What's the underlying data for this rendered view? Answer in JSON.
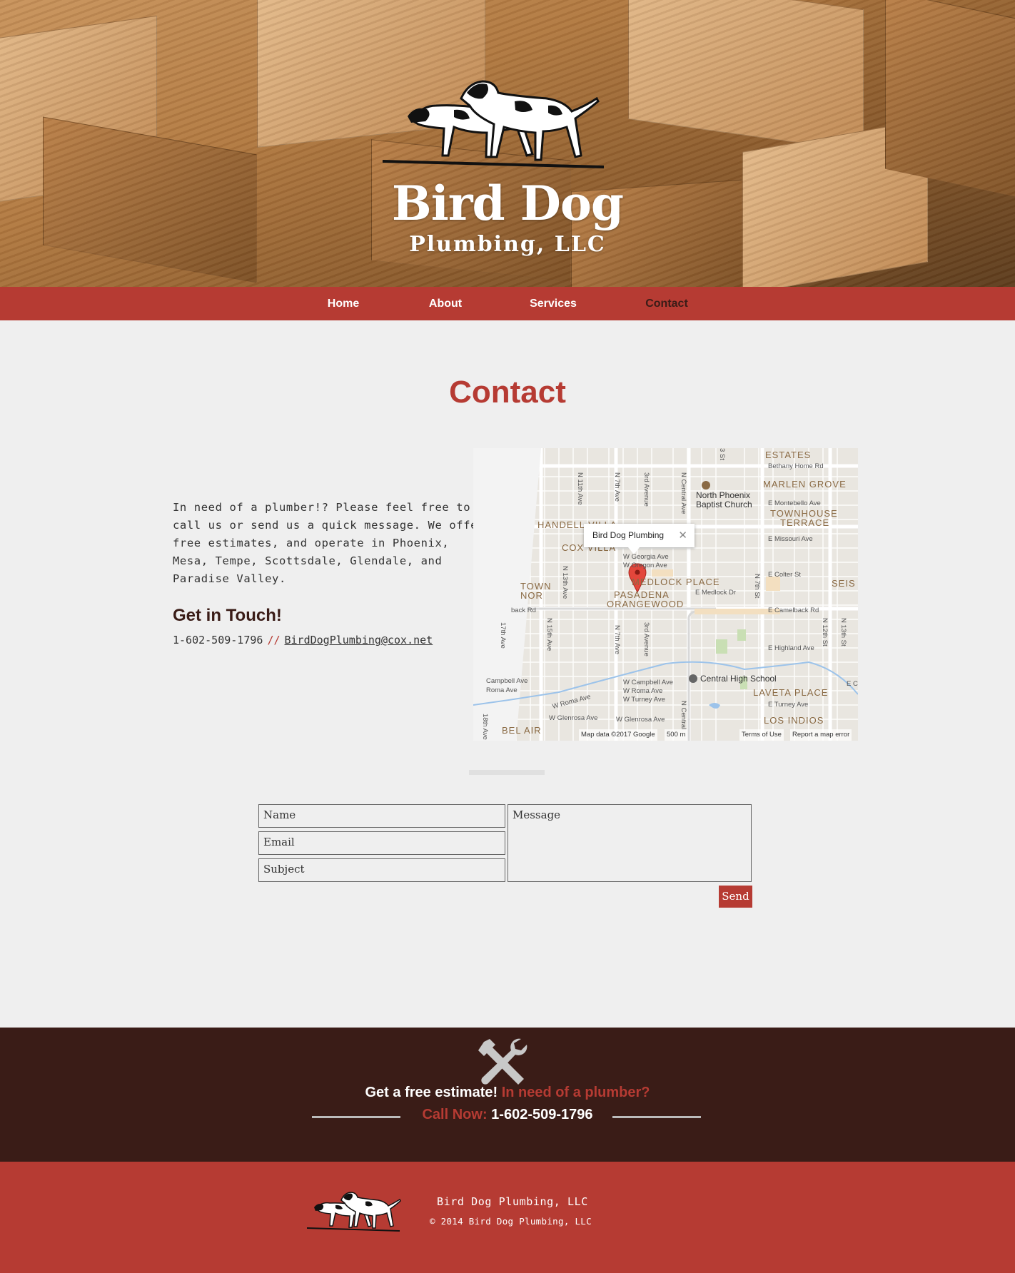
{
  "brand": {
    "name": "Bird Dog",
    "subtitle": "Plumbing, LLC"
  },
  "nav": {
    "items": [
      {
        "label": "Home"
      },
      {
        "label": "About"
      },
      {
        "label": "Services"
      },
      {
        "label": "Contact",
        "active": true
      }
    ]
  },
  "page": {
    "title": "Contact",
    "intro": "In need of a plumber!? Please feel free to call us or send us a quick message. We offer free estimates, and operate in Phoenix, Mesa, Tempe, Scottsdale, Glendale, and Paradise Valley.",
    "get_in_touch": "Get in Touch!",
    "phone": "1-602-509-1796",
    "separator": "//",
    "email": "BirdDogPlumbing@cox.net"
  },
  "map": {
    "popup_title": "Bird Dog Plumbing",
    "popup_close": "✕",
    "neighborhoods": [
      "ESTATES",
      "MARLEN GROVE",
      "TOWNHOUSE",
      "TERRACE",
      "HANDELL VILLA",
      "COX VILLA",
      "MEDLOCK PLACE",
      "PASADENA",
      "ORANGEWOOD",
      "SEIS",
      "TOWN",
      "NOR",
      "LAVETA PLACE",
      "LOS INDIOS",
      "BEL AIR"
    ],
    "streets": [
      "Bethany Home Rd",
      "E Montebello Ave",
      "E Missouri Ave",
      "E Colter St",
      "E Medlock Dr",
      "E Camelback Rd",
      "E Highland Ave",
      "E Turney Ave",
      "W Georgia Ave",
      "W Oregon Ave",
      "W Campbell Ave",
      "W Roma Ave",
      "W Turney Ave",
      "W Glenrosa Ave",
      "Campbell Ave",
      "Roma Ave",
      "W Roma Ave",
      "W Glenrosa Ave",
      "back Rd",
      "E Can"
    ],
    "vertical_streets": [
      "N 11th Ave",
      "N 7th Ave",
      "3rd Avenue",
      "N Central Ave",
      "N 13th Ave",
      "N 15th Ave",
      "N 7th Ave",
      "3rd Avenue",
      "N Central",
      "N 7th St",
      "N 12th St",
      "N 13th St",
      "18th Ave",
      "17th Ave",
      "3 St"
    ],
    "pois": [
      "North Phoenix",
      "Baptist Church",
      "Central High School"
    ],
    "attribution": {
      "data": "Map data ©2017 Google",
      "scale": "500 m",
      "terms": "Terms of Use",
      "report": "Report a map error"
    }
  },
  "form": {
    "name_placeholder": "Name",
    "email_placeholder": "Email",
    "subject_placeholder": "Subject",
    "message_placeholder": "Message",
    "send_label": "Send"
  },
  "cta": {
    "lead": "Get a free estimate!",
    "question": "In need of a plumber?",
    "call_label": "Call Now:",
    "phone": "1-602-509-1796",
    "icon": "wrench-hammer-icon"
  },
  "footer": {
    "company": "Bird Dog Plumbing, LLC",
    "copyright": "© 2014 Bird Dog Plumbing, LLC"
  },
  "colors": {
    "accent": "#b63b33",
    "dark": "#3a1c17",
    "background": "#efefef"
  }
}
